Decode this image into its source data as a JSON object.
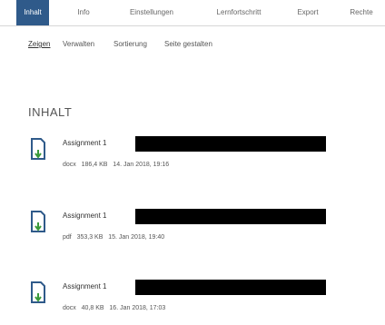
{
  "tabs": [
    {
      "label": "Inhalt",
      "active": true
    },
    {
      "label": "Info"
    },
    {
      "label": "Einstellungen"
    },
    {
      "label": "Lernfortschritt"
    },
    {
      "label": "Export"
    },
    {
      "label": "Rechte"
    }
  ],
  "subtabs": [
    {
      "label": "Zeigen",
      "active": true
    },
    {
      "label": "Verwalten"
    },
    {
      "label": "Sortierung"
    },
    {
      "label": "Seite gestalten"
    }
  ],
  "section_heading": "INHALT",
  "items": [
    {
      "title": "Assignment 1",
      "type": "docx",
      "size": "186,4 KB",
      "date": "14. Jan 2018, 19:16",
      "icon": "file-download-icon"
    },
    {
      "title": "Assignment 1",
      "type": "pdf",
      "size": "353,3 KB",
      "date": "15. Jan 2018, 19:40",
      "icon": "file-download-icon"
    },
    {
      "title": "Assignment 1",
      "type": "docx",
      "size": "40,8 KB",
      "date": "16. Jan 2018, 17:03",
      "icon": "file-download-icon"
    }
  ],
  "colors": {
    "active_tab": "#2f5a8a",
    "icon_blue": "#2f5a8a",
    "icon_green": "#3a9a3a"
  }
}
